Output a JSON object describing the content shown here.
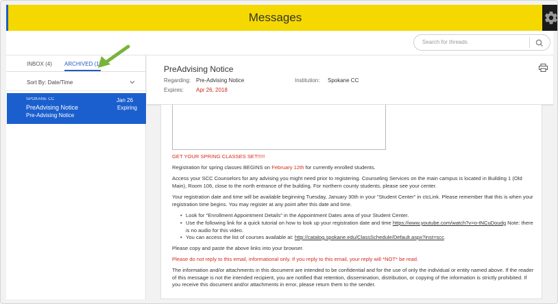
{
  "header": {
    "title": "Messages"
  },
  "search": {
    "placeholder": "Search for threads"
  },
  "tabs": {
    "inbox": "INBOX (4)",
    "archived": "ARCHIVED (1)"
  },
  "sort": {
    "label": "Sort By: Date/Time"
  },
  "thread": {
    "institution": "SPOKANE CC",
    "date": "Jan 26",
    "title": "PreAdvising Notice",
    "status": "Expiring",
    "subtitle": "Pre-Advising Notice"
  },
  "message": {
    "title": "PreAdvising Notice",
    "regarding_label": "Regarding:",
    "regarding_value": "Pre-Advising Notice",
    "institution_label": "Institution:",
    "institution_value": "Spokane CC",
    "expires_label": "Expires:",
    "expires_value": "Apr 26, 2018"
  },
  "body": {
    "headline": "GET YOUR SPRING CLASSES SET!!!!!",
    "p1_a": "Registration for spring classes BEGINS on ",
    "p1_date": "February 12th",
    "p1_b": " for currently enrolled students.",
    "p2": "Access your SCC Counselors for any advising you might need prior to registering.  Counseling Services on the main campus is located in Building 1 (Old Main), Room 106, close to the north entrance of the building.  For northern county students, please see your center.",
    "p3": "Your registration date and time will be available beginning Tuesday, January 30th in your \"Student Center\" in ctcLink.  Please remember that this is when your registration time begins.  You may register at any point after this date and time.",
    "b1": "Look for \"Enrollment Appointment Details\" in the Appointment Dates area of your Student Center.",
    "b2_a": "Use the following link for a quick tutorial on how to look up your registration date and time ",
    "b2_link": " https://www.youtube.com/watch?v=o-tNCuDoudg",
    "b2_b": "  Note: there is no audio for this video.",
    "b3_a": "You can access the list of courses available at: ",
    "b3_link": "http://catalog.spokane.edu/ClassSchedule/Default.aspx?inst=scc",
    "b3_b": ".",
    "p4": "Please copy and paste the above links into your browser.",
    "p5": "Please do not reply to this email, informational only. If you reply to this email, your reply will *NOT* be read.",
    "p6": "The information and/or attachments in this document are intended to be confidential and for the use of only the individual or entity named above.  If the reader of this message is not the intended recipient, you are notified that retention, dissemination, distribution, or copying of the information is strictly prohibited.  If you receive this document and/or attachments in error, please return them to the sender."
  },
  "icons": {
    "gear": "gear-icon",
    "search": "search-icon",
    "printer": "printer-icon",
    "chevron": "chevron-down-icon",
    "arrow": "annotation-arrow-icon"
  },
  "colors": {
    "header_yellow": "#f5d800",
    "accent_blue": "#1b5fce",
    "alert_red": "#d42a1a",
    "arrow_green": "#7ab33b"
  }
}
